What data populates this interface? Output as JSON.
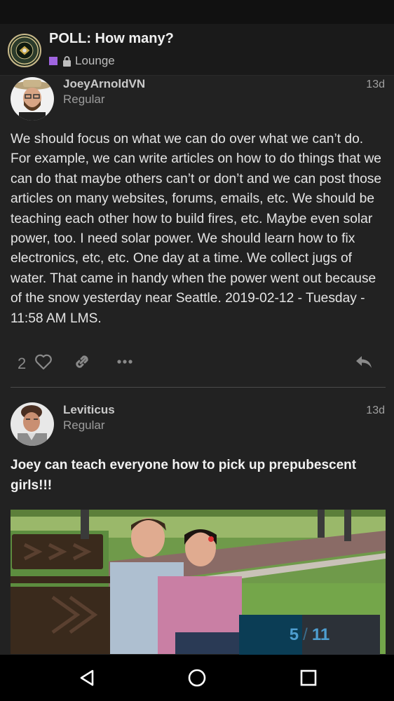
{
  "topic": {
    "title": "POLL: How many?",
    "category": "Lounge",
    "category_color": "#a065e0",
    "logo_icon": "seal-logo-icon"
  },
  "posts": [
    {
      "username": "JoeyArnoldVN",
      "user_title": "Regular",
      "date": "13d",
      "body": "We should focus on what we can do over what we can’t do. For example, we can write articles on how to do things that we can do that maybe others can’t or don’t and we can post those articles on many websites, forums, emails, etc. We should be teaching each other how to build fires, etc. Maybe even solar power, too. I need solar power. We should learn how to fix electronics, etc, etc. One day at a time. We collect jugs of water. That came in handy when the power went out because of the snow yesterday near Seattle. 2019-02-12 - Tuesday - 11:58 AM LMS.",
      "like_count": "2",
      "icons": [
        "heart-icon",
        "link-icon",
        "more-icon",
        "reply-icon"
      ]
    },
    {
      "username": "Leviticus",
      "user_title": "Regular",
      "date": "13d",
      "body": "Joey can teach everyone how to pick up prepubescent girls!!!"
    }
  ],
  "progress": {
    "current": "5",
    "total": "11",
    "separator": "/",
    "fraction": 0.45
  },
  "accent_color": "#4e9ed0"
}
